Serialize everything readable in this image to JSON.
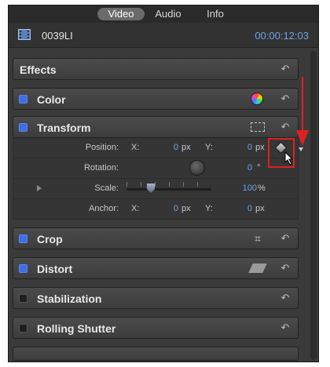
{
  "tabs": [
    {
      "label": "Video",
      "selected": true
    },
    {
      "label": "Audio",
      "selected": false
    },
    {
      "label": "Info",
      "selected": false
    }
  ],
  "clip": {
    "name": "0039LI",
    "timecode": "00:00:12:03",
    "icon": "film-strip-icon"
  },
  "sections": {
    "effects": {
      "label": "Effects"
    },
    "color": {
      "label": "Color",
      "enabled": true,
      "icon": "color-wheel-icon"
    },
    "transform": {
      "label": "Transform",
      "enabled": true,
      "icon": "transform-bounding-box-icon"
    },
    "crop": {
      "label": "Crop",
      "enabled": true,
      "icon": "crop-icon"
    },
    "distort": {
      "label": "Distort",
      "enabled": true,
      "icon": "distort-icon"
    },
    "stabilization": {
      "label": "Stabilization",
      "enabled": false
    },
    "rolling_shutter": {
      "label": "Rolling Shutter",
      "enabled": false
    }
  },
  "transform": {
    "position": {
      "label": "Position:",
      "x_label": "X:",
      "x": "0",
      "x_unit": "px",
      "y_label": "Y:",
      "y": "0",
      "y_unit": "px"
    },
    "rotation": {
      "label": "Rotation:",
      "value": "0",
      "unit": "°"
    },
    "scale": {
      "label": "Scale:",
      "value": "100",
      "unit": "%"
    },
    "anchor": {
      "label": "Anchor:",
      "x_label": "X:",
      "x": "0",
      "x_unit": "px",
      "y_label": "Y:",
      "y": "0",
      "y_unit": "px"
    }
  },
  "reset_icon": "reset-arrow-icon",
  "keyframe_icon": "keyframe-diamond-icon",
  "colors": {
    "accent_blue": "#6fa3e6",
    "checkbox_on": "#3f6ee6",
    "annotation_red": "#e02020"
  }
}
